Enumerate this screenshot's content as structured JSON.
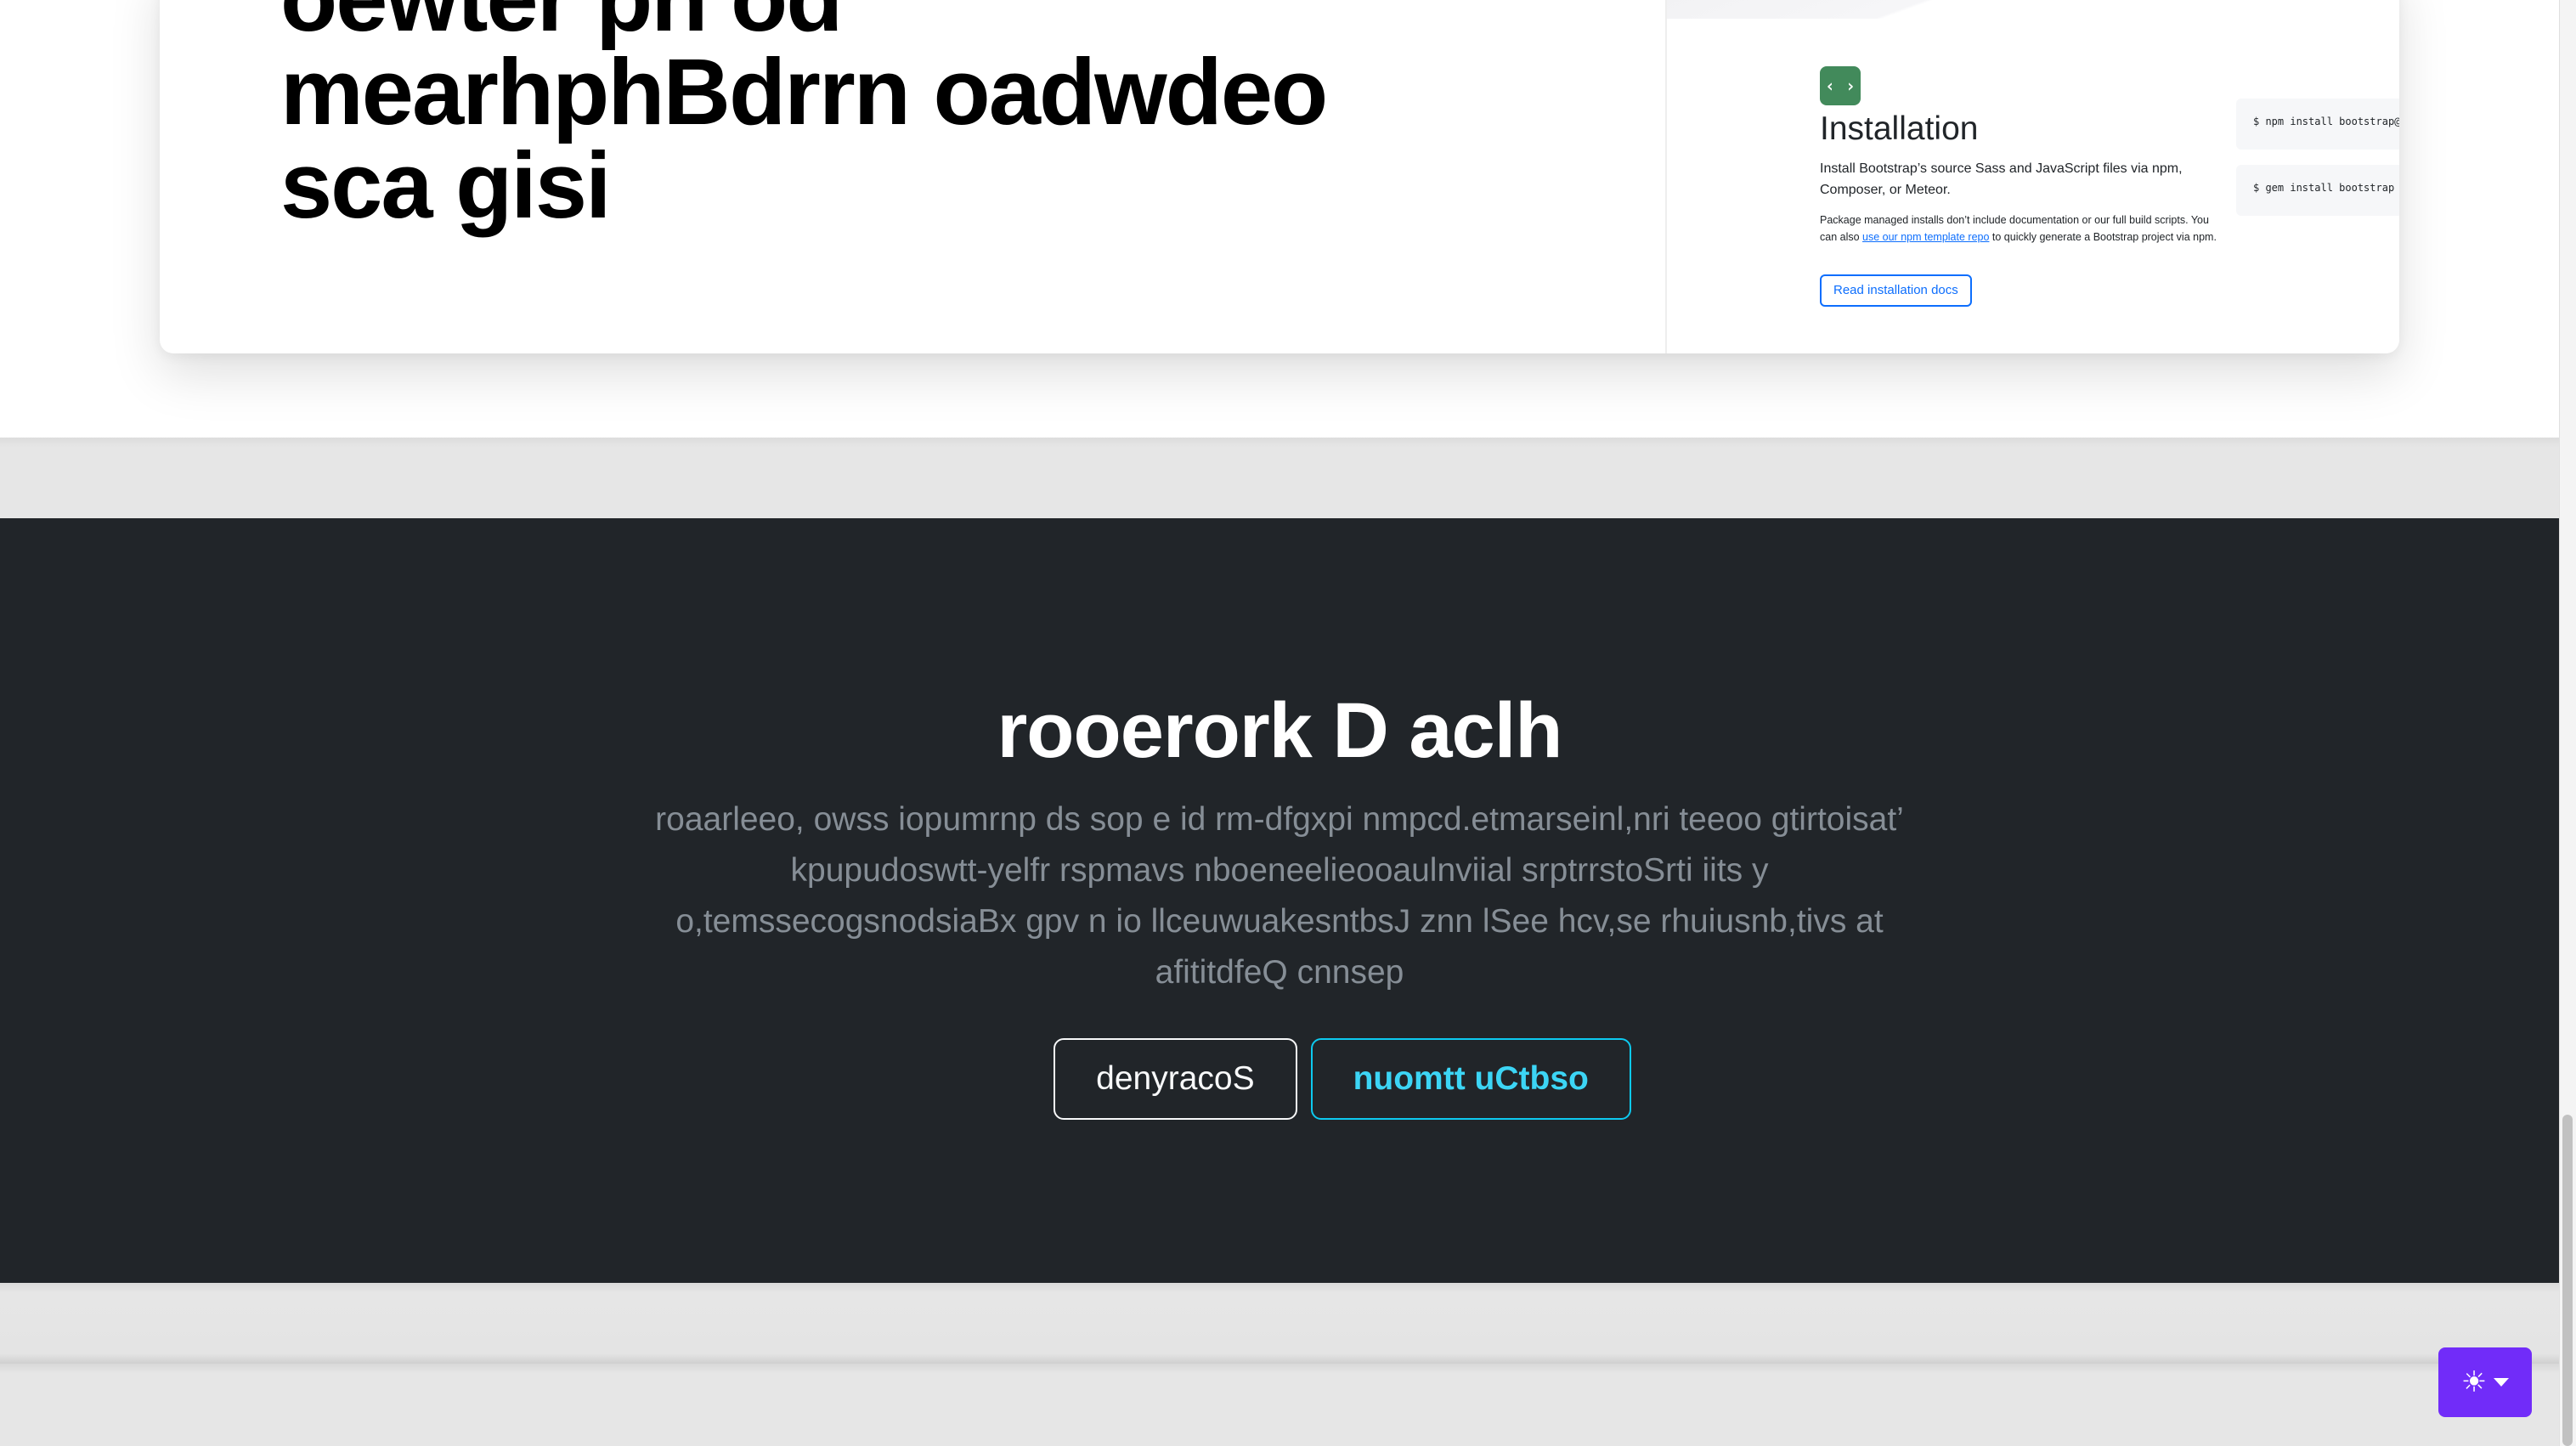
{
  "hero": {
    "title": "oewter pn od\nmearhphBdrrn oadwdeo\nsca gisi"
  },
  "preview": {
    "icon": "code-icon",
    "icon_glyph": "‹ ›",
    "heading": "Installation",
    "lead": "Install Bootstrap’s source Sass and JavaScript files via npm, Composer, or Meteor.",
    "small_before": "Package managed installs don’t include documentation or our full build scripts. You can also ",
    "small_link": "use our npm template repo",
    "small_after": " to quickly generate a Bootstrap project via npm.",
    "button_label": "Read installation docs",
    "code_npm": "$ npm install bootstrap@n",
    "code_gem": "$ gem install bootstrap -"
  },
  "dark_section": {
    "title": "rooerork D aclh",
    "lead": "roaarleeo, owss iopumrnp ds sop e id rm-dfgxpi nmpcd.etmarseinl,nri teeoo gtirtoisat’ kpupudoswtt-yelfr rspmavs nboeneelieooaulnviial srptrrstoSrti iits y o,temssecogsnodsiaBx gpv n io llceuwuakesntbsJ znn lSee hcv,se rhuiusnb,tivs at afititdfeQ cnnsep",
    "button_light": "denyracoS",
    "button_info": "nuomtt uCtbso"
  },
  "theme_toggle": {
    "icon": "sun-icon",
    "glyph": "☀",
    "caret": "chevron-down-icon"
  },
  "colors": {
    "dark_bg": "#212529",
    "accent_purple": "#712cf9",
    "info": "#0dcaf0",
    "install_icon_green": "#428a5b"
  }
}
